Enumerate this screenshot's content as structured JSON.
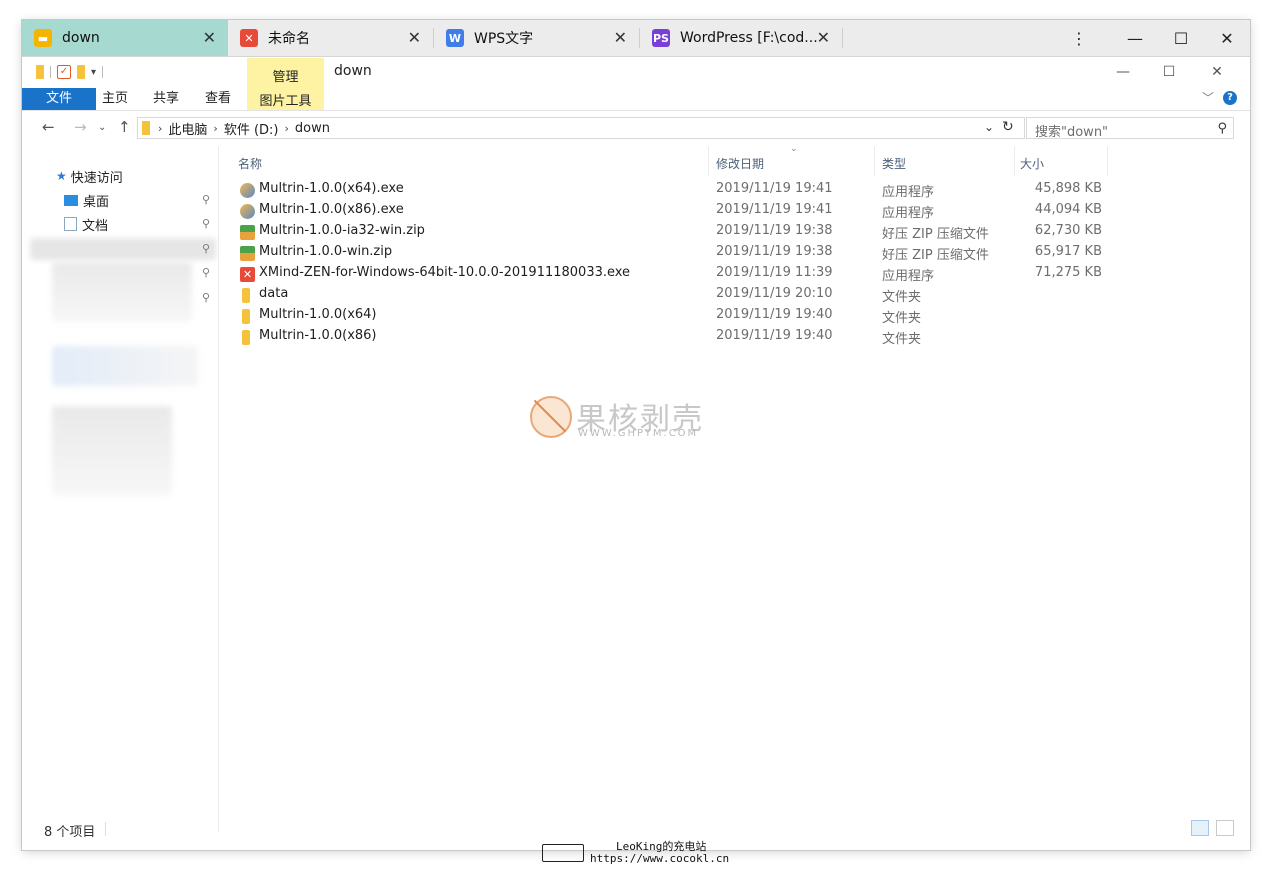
{
  "tabs": [
    {
      "label": "down",
      "icon": "folder-tab-icon",
      "color": "#f4b400"
    },
    {
      "label": "未命名",
      "icon": "xmind-tab-icon",
      "color": "#e84a3a"
    },
    {
      "label": "WPS文字",
      "icon": "wps-writer-tab-icon",
      "color": "#3f7ee8"
    },
    {
      "label": "WordPress [F:\\cod...",
      "icon": "phpstorm-tab-icon",
      "color": "#7a3fd9"
    }
  ],
  "tab_close": "✕",
  "window_controls": {
    "menu": "⋮",
    "minimize": "—",
    "maximize": "☐",
    "close": "✕"
  },
  "ribbon": {
    "manage": "管理",
    "picture_tools": "图片工具",
    "title": "down",
    "file": "文件",
    "home": "主页",
    "share": "共享",
    "view": "查看"
  },
  "address": {
    "crumbs": [
      "此电脑",
      "软件 (D:)",
      "down"
    ],
    "search_placeholder": "搜索\"down\""
  },
  "nav": {
    "quick_access": "快速访问",
    "desktop": "桌面",
    "documents": "文档"
  },
  "columns": {
    "name": "名称",
    "date": "修改日期",
    "type": "类型",
    "size": "大小"
  },
  "files": [
    {
      "name": "Multrin-1.0.0(x64).exe",
      "date": "2019/11/19 19:41",
      "type": "应用程序",
      "size": "45,898 KB",
      "icon": "installer-icon"
    },
    {
      "name": "Multrin-1.0.0(x86).exe",
      "date": "2019/11/19 19:41",
      "type": "应用程序",
      "size": "44,094 KB",
      "icon": "installer-icon"
    },
    {
      "name": "Multrin-1.0.0-ia32-win.zip",
      "date": "2019/11/19 19:38",
      "type": "好压 ZIP 压缩文件",
      "size": "62,730 KB",
      "icon": "zip-archive-icon"
    },
    {
      "name": "Multrin-1.0.0-win.zip",
      "date": "2019/11/19 19:38",
      "type": "好压 ZIP 压缩文件",
      "size": "65,917 KB",
      "icon": "zip-archive-icon"
    },
    {
      "name": "XMind-ZEN-for-Windows-64bit-10.0.0-201911180033.exe",
      "date": "2019/11/19 11:39",
      "type": "应用程序",
      "size": "71,275 KB",
      "icon": "xmind-exe-icon"
    },
    {
      "name": "data",
      "date": "2019/11/19 20:10",
      "type": "文件夹",
      "size": "",
      "icon": "folder-icon"
    },
    {
      "name": "Multrin-1.0.0(x64)",
      "date": "2019/11/19 19:40",
      "type": "文件夹",
      "size": "",
      "icon": "folder-icon"
    },
    {
      "name": "Multrin-1.0.0(x86)",
      "date": "2019/11/19 19:40",
      "type": "文件夹",
      "size": "",
      "icon": "folder-icon"
    }
  ],
  "watermark": {
    "title": "果核剥壳",
    "url": "WWW.GHPYM.COM"
  },
  "status": {
    "count": "8 个项目"
  },
  "footer": {
    "line1": "LeoKing的充电站",
    "line2": "https://www.cocokl.cn"
  },
  "colors": {
    "active_tab": "#a6dad1",
    "file_tab": "#1a73c8",
    "manage_tab": "#fdf3a3",
    "folder": "#f4c23b"
  }
}
